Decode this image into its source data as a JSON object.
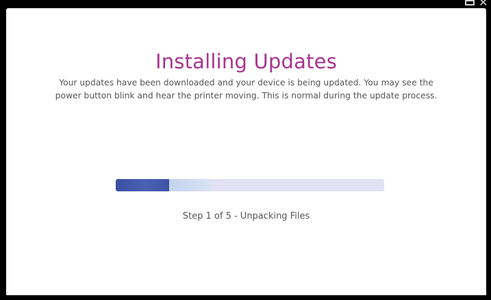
{
  "screen": {
    "title": "Installing Updates",
    "description_line1": "Your updates have been downloaded and your device is being updated. You may see the",
    "description_line2": "power button blink and hear the printer moving. This is normal during the update process.",
    "progress": {
      "fraction": 0.2,
      "step_text": "Step 1 of 5 - Unpacking Files"
    }
  },
  "colors": {
    "title": "#a8348f",
    "body_text": "#555555",
    "progress_fill": "#3a4fa0",
    "progress_track": "#e1e1f3",
    "background": "#ffffff",
    "frame": "#000000"
  },
  "icons": {
    "window": "window-restore-icon",
    "close": "close-icon"
  }
}
